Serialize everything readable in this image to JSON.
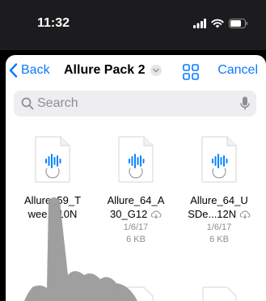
{
  "status": {
    "time": "11:32"
  },
  "nav": {
    "back_label": "Back",
    "title": "Allure Pack 2",
    "cancel_label": "Cancel"
  },
  "search": {
    "placeholder": "Search"
  },
  "files": [
    {
      "name_line1": "Allure_59_T",
      "name_line2": "wee…10N",
      "date": "",
      "size": ""
    },
    {
      "name_line1": "Allure_64_A",
      "name_line2": "30_G12",
      "date": "1/6/17",
      "size": "6 KB"
    },
    {
      "name_line1": "Allure_64_U",
      "name_line2": "SDe...12N",
      "date": "1/6/17",
      "size": "6 KB"
    }
  ],
  "colors": {
    "accent": "#0a7aff",
    "doc_icon_blue": "#0a84ff",
    "hand": "#9a9a9a"
  }
}
